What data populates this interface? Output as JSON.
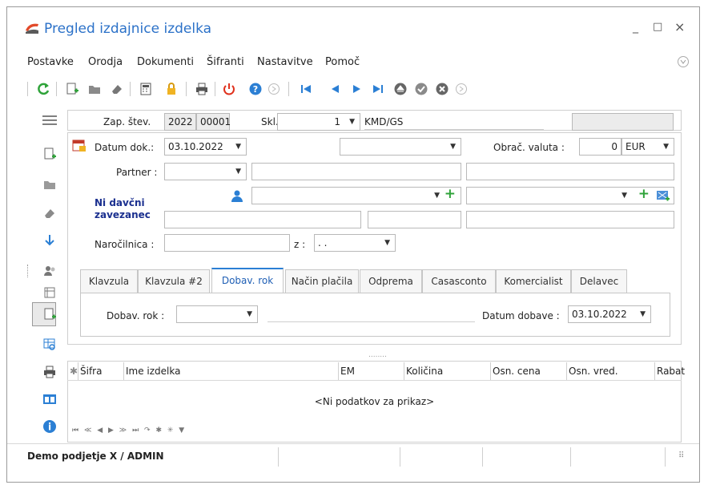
{
  "window": {
    "title": "Pregled izdajnice izdelka",
    "minimize": "_",
    "maximize": "□",
    "close": "×"
  },
  "menu": [
    "Postavke",
    "Orodja",
    "Dokumenti",
    "Šifranti",
    "Nastavitve",
    "Pomoč"
  ],
  "header": {
    "zap_label": "Zap. štev.",
    "zap_year": "2022",
    "zap_number": "00001",
    "skl_label": "Skl.",
    "skl_value": "1",
    "skl_name": "KMD/GS"
  },
  "form": {
    "datum_label": "Datum dok.:",
    "datum_value": "03.10.2022",
    "obrac_label": "Obrač. valuta :",
    "obrac_value": "0",
    "currency": "EUR",
    "partner_label": "Partner :",
    "tax_note_line1": "Ni davčni",
    "tax_note_line2": "zavezanec",
    "narocilnica_label": "Naročilnica :",
    "z_label": "z :",
    "z_value": ". ."
  },
  "tabs": [
    "Klavzula",
    "Klavzula #2",
    "Dobav. rok",
    "Način plačila",
    "Odprema",
    "Casasconto",
    "Komercialist",
    "Delavec"
  ],
  "active_tab": "Dobav. rok",
  "tab_content": {
    "dobav_label": "Dobav. rok :",
    "datum_dobave_label": "Datum dobave :",
    "datum_dobave_value": "03.10.2022"
  },
  "grid": {
    "columns": [
      "Šifra",
      "Ime izdelka",
      "EM",
      "Količina",
      "Osn. cena",
      "Osn. vred.",
      "Rabat"
    ],
    "empty_text": "<Ni podatkov za prikaz>"
  },
  "status": {
    "text": "Demo podjetje X / ADMIN"
  }
}
